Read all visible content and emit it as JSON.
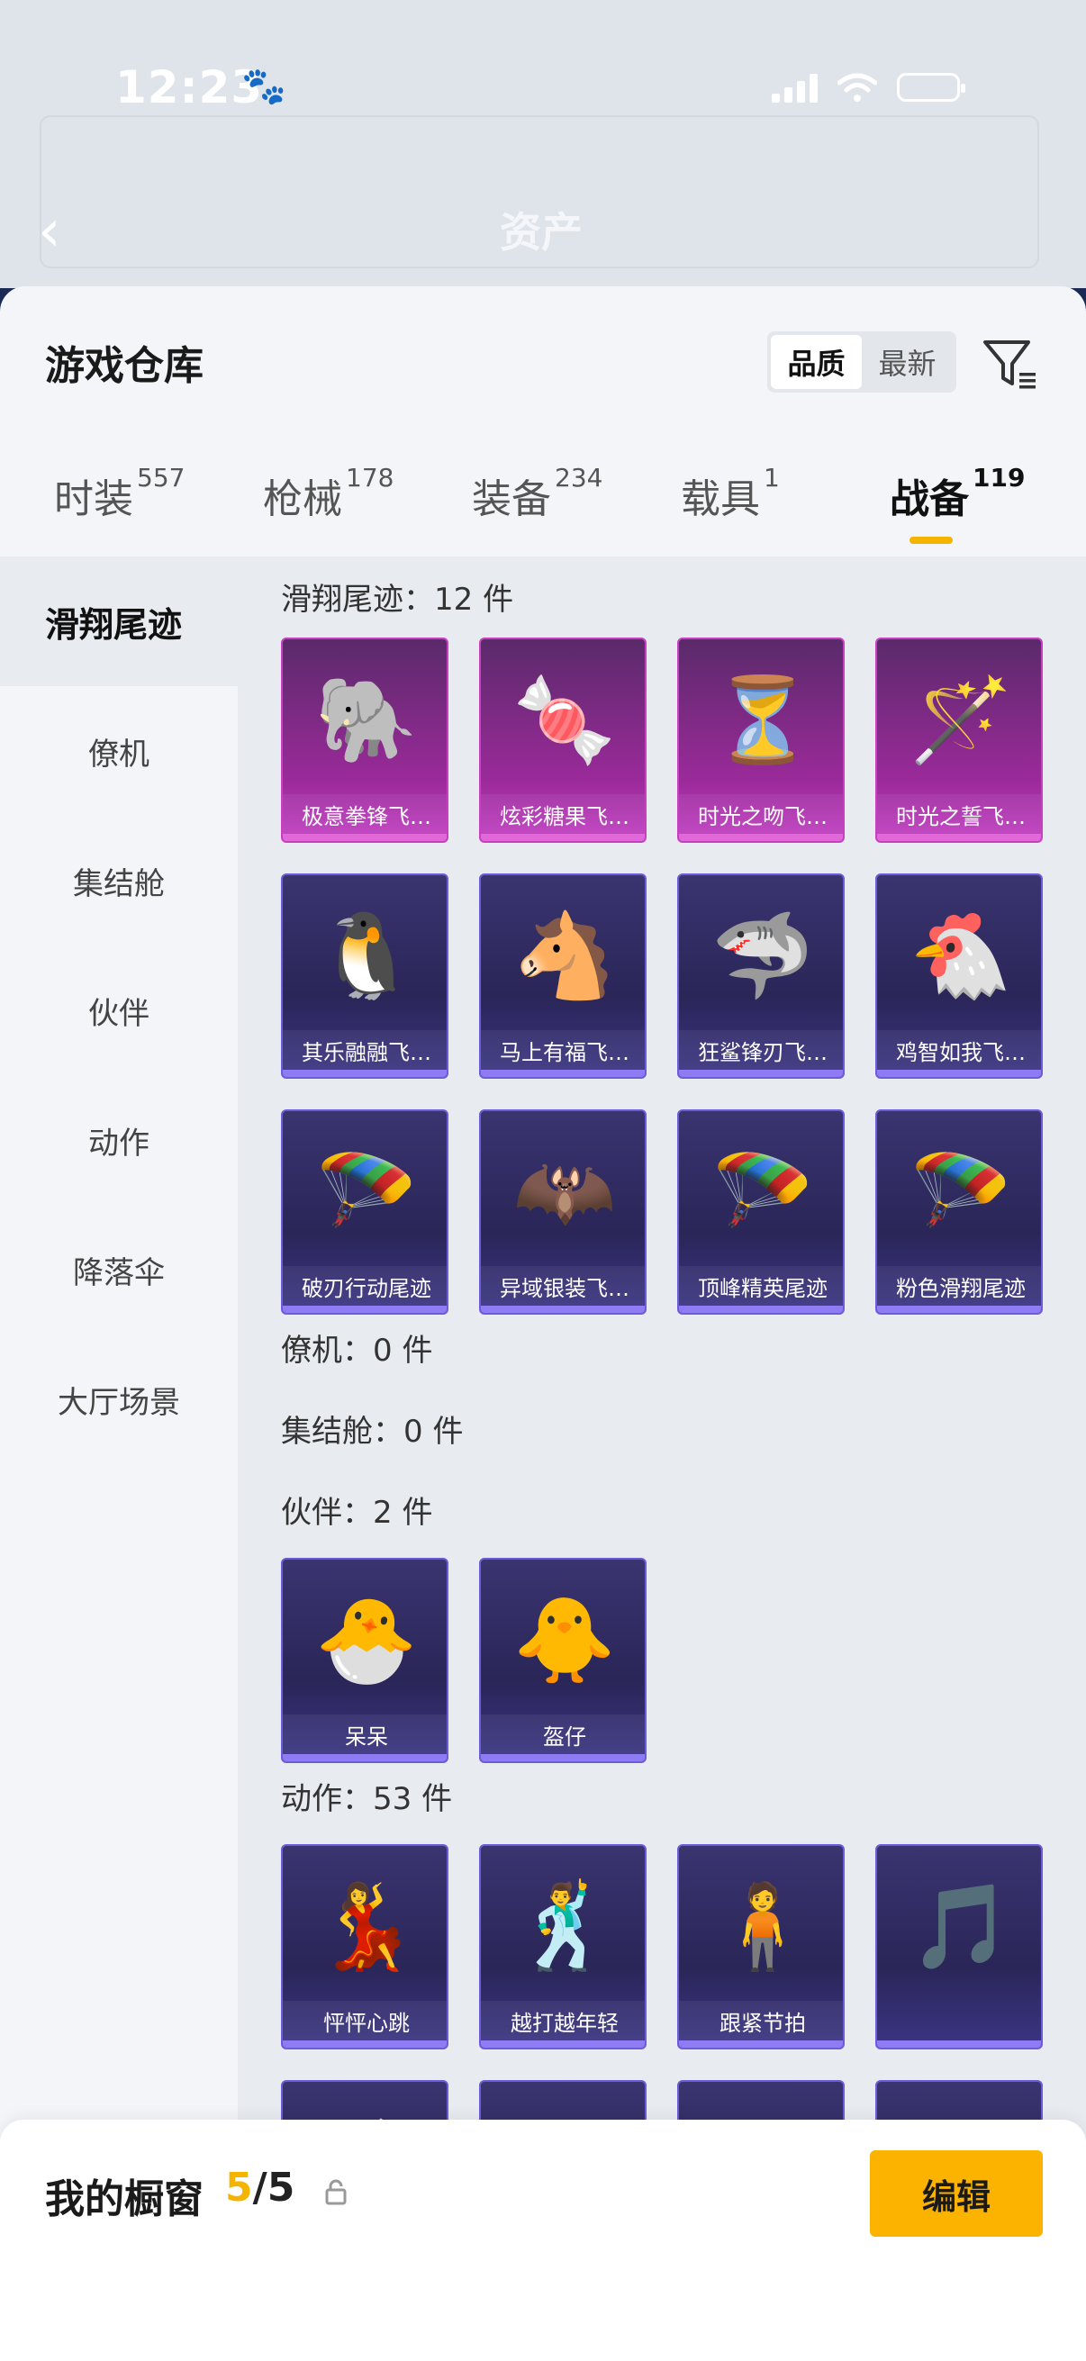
{
  "status": {
    "time": "12:23"
  },
  "nav": {
    "title": "资产"
  },
  "header": {
    "title": "游戏仓库",
    "sort_quality": "品质",
    "sort_latest": "最新"
  },
  "tabs": [
    {
      "label": "时装",
      "count": "557"
    },
    {
      "label": "枪械",
      "count": "178"
    },
    {
      "label": "装备",
      "count": "234"
    },
    {
      "label": "载具",
      "count": "1"
    },
    {
      "label": "战备",
      "count": "119"
    }
  ],
  "sidebar": [
    "滑翔尾迹",
    "僚机",
    "集结舱",
    "伙伴",
    "动作",
    "降落伞",
    "大厅场景"
  ],
  "sections": {
    "glide": {
      "title": "滑翔尾迹：12 件",
      "items": [
        "极意拳锋飞…",
        "炫彩糖果飞…",
        "时光之吻飞…",
        "时光之誓飞…",
        "其乐融融飞…",
        "马上有福飞…",
        "狂鲨锋刃飞…",
        "鸡智如我飞…",
        "破刃行动尾迹",
        "异域银装飞…",
        "顶峰精英尾迹",
        "粉色滑翔尾迹"
      ]
    },
    "wingman": {
      "title": "僚机：0 件"
    },
    "pod": {
      "title": "集结舱：0 件"
    },
    "partner": {
      "title": "伙伴：2 件",
      "items": [
        "呆呆",
        "盔仔"
      ]
    },
    "emote": {
      "title": "动作：53 件",
      "items": [
        "怦怦心跳",
        "越打越年轻",
        "跟紧节拍"
      ]
    }
  },
  "bottom": {
    "label": "我的橱窗",
    "current": "5",
    "total": "/5",
    "edit": "编辑"
  },
  "colors": {
    "accent": "#fbb300",
    "gold_card": "#c13fc3",
    "purple_card": "#3b3584"
  }
}
